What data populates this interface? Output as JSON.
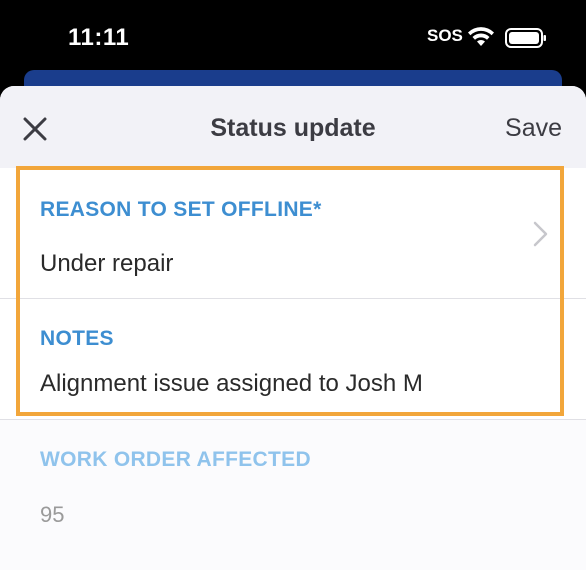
{
  "status_bar": {
    "time": "11:11",
    "carrier_text": "SOS",
    "icons": [
      "wifi-icon",
      "battery-icon"
    ]
  },
  "header": {
    "close_icon": "close-icon",
    "title": "Status update",
    "save_label": "Save"
  },
  "form": {
    "reason": {
      "label": "REASON TO SET OFFLINE*",
      "value": "Under repair",
      "icon": "chevron-right-icon"
    },
    "notes": {
      "label": "NOTES",
      "value": "Alignment issue assigned to Josh M"
    },
    "work_order": {
      "label": "WORK ORDER AFFECTED",
      "value": "95"
    }
  },
  "colors": {
    "accent_label": "#3d8ed1",
    "disabled_label": "#8fc3ec",
    "highlight_border": "#f2a63a",
    "app_bar": "#1a3d8c"
  }
}
